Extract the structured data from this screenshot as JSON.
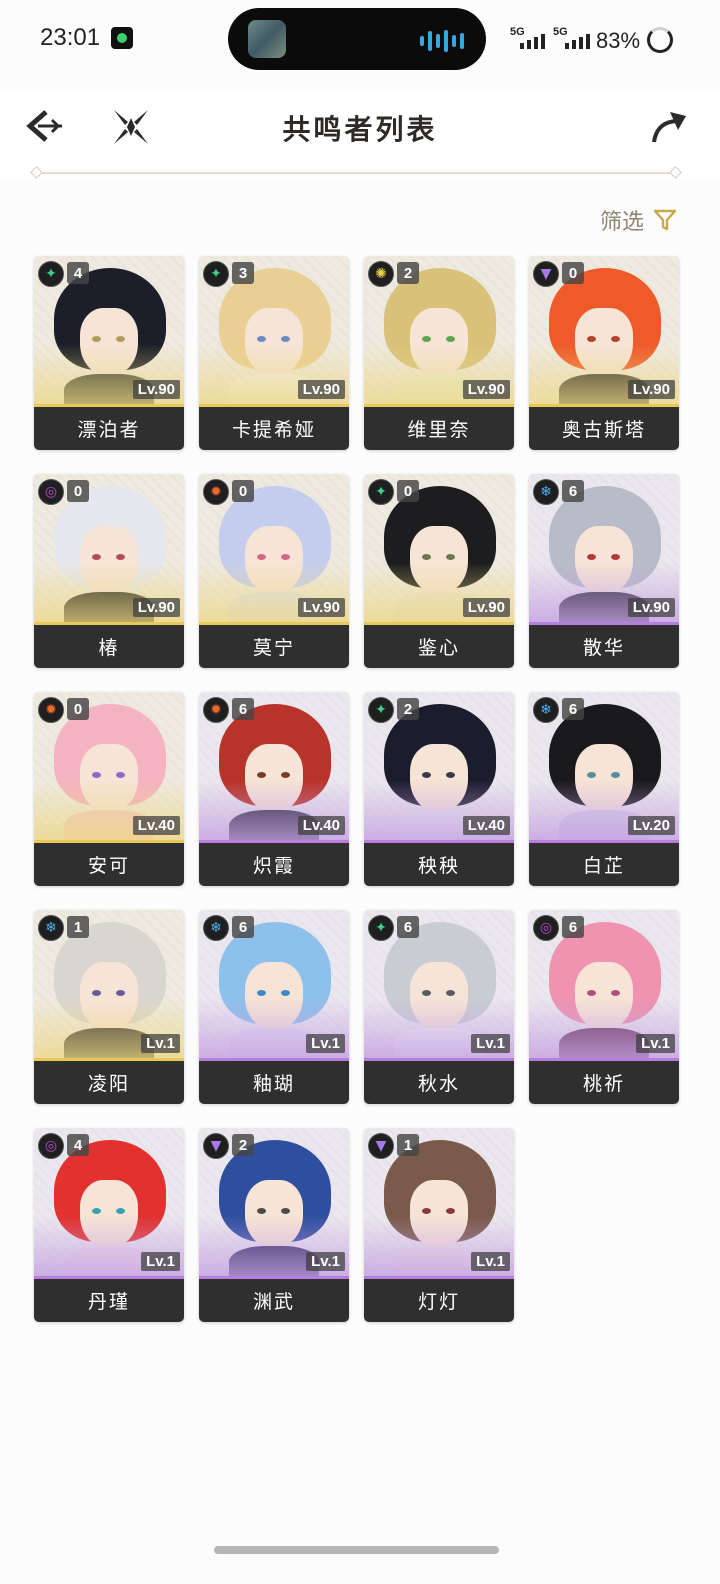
{
  "status_bar": {
    "time": "23:01",
    "network_1": "5G",
    "network_2": "5G",
    "battery": "83%"
  },
  "header": {
    "title": "共鸣者列表",
    "back_icon": "back-arrow-icon",
    "center_icon": "cross-blades-icon",
    "share_icon": "share-arrow-icon"
  },
  "filter": {
    "label": "筛选",
    "icon": "funnel-filter-icon"
  },
  "element_colors": {
    "aero": "#3ecf8e",
    "spectro": "#e8d14a",
    "havoc": "#c14bd8",
    "fusion": "#ef6a2a",
    "glacio": "#4ab0f0",
    "electro": "#a777ee"
  },
  "characters": [
    {
      "name": "漂泊者",
      "level": "Lv.90",
      "chain": "4",
      "element": "aero",
      "rarity": "gold",
      "hair": "#1c1f2a",
      "eye": "#b49a5a",
      "outfit": "#3b3f35"
    },
    {
      "name": "卡提希娅",
      "level": "Lv.90",
      "chain": "3",
      "element": "aero",
      "rarity": "gold",
      "hair": "#e9cf93",
      "eye": "#6a8ac6",
      "outfit": "#f3efe6"
    },
    {
      "name": "维里奈",
      "level": "Lv.90",
      "chain": "2",
      "element": "spectro",
      "rarity": "gold",
      "hair": "#d8c27a",
      "eye": "#5fa34f",
      "outfit": "#e8ecd3"
    },
    {
      "name": "奥古斯塔",
      "level": "Lv.90",
      "chain": "0",
      "element": "electro",
      "rarity": "gold",
      "hair": "#ef5a2a",
      "eye": "#b0442a",
      "outfit": "#343030"
    },
    {
      "name": "椿",
      "level": "Lv.90",
      "chain": "0",
      "element": "havoc",
      "rarity": "gold",
      "hair": "#e6e7ec",
      "eye": "#b34a5a",
      "outfit": "#2a2a2a"
    },
    {
      "name": "莫宁",
      "level": "Lv.90",
      "chain": "0",
      "element": "fusion",
      "rarity": "gold",
      "hair": "#c4cdee",
      "eye": "#d06a8a",
      "outfit": "#dfe1ee"
    },
    {
      "name": "鉴心",
      "level": "Lv.90",
      "chain": "0",
      "element": "aero",
      "rarity": "gold",
      "hair": "#1d1d1f",
      "eye": "#6a7a4a",
      "outfit": "#e9e4d4"
    },
    {
      "name": "散华",
      "level": "Lv.90",
      "chain": "6",
      "element": "glacio",
      "rarity": "purple",
      "hair": "#b8bcc8",
      "eye": "#b33a3a",
      "outfit": "#2f2d38"
    },
    {
      "name": "安可",
      "level": "Lv.40",
      "chain": "0",
      "element": "fusion",
      "rarity": "gold",
      "hair": "#f3b3c0",
      "eye": "#8a6ac6",
      "outfit": "#f2c9c9"
    },
    {
      "name": "炽霞",
      "level": "Lv.40",
      "chain": "6",
      "element": "fusion",
      "rarity": "purple",
      "hair": "#b8342a",
      "eye": "#7a3a2a",
      "outfit": "#2a2a36"
    },
    {
      "name": "秧秧",
      "level": "Lv.40",
      "chain": "2",
      "element": "aero",
      "rarity": "purple",
      "hair": "#1b1d2c",
      "eye": "#3a3a4a",
      "outfit": "#e9e9ef"
    },
    {
      "name": "白芷",
      "level": "Lv.20",
      "chain": "6",
      "element": "glacio",
      "rarity": "purple",
      "hair": "#1a1a1c",
      "eye": "#5a8aa0",
      "outfit": "#d7cfe6"
    },
    {
      "name": "凌阳",
      "level": "Lv.1",
      "chain": "1",
      "element": "glacio",
      "rarity": "gold",
      "hair": "#d9d6cf",
      "eye": "#6a5aa0",
      "outfit": "#3a3a3a"
    },
    {
      "name": "釉瑚",
      "level": "Lv.1",
      "chain": "6",
      "element": "glacio",
      "rarity": "purple",
      "hair": "#8ec0ec",
      "eye": "#3a8ac8",
      "outfit": "#e2dcf0"
    },
    {
      "name": "秋水",
      "level": "Lv.1",
      "chain": "6",
      "element": "aero",
      "rarity": "purple",
      "hair": "#c9ccd3",
      "eye": "#5a5a6a",
      "outfit": "#f0f0f4"
    },
    {
      "name": "桃祈",
      "level": "Lv.1",
      "chain": "6",
      "element": "havoc",
      "rarity": "purple",
      "hair": "#ef93b0",
      "eye": "#b0507a",
      "outfit": "#6a3a5a"
    },
    {
      "name": "丹瑾",
      "level": "Lv.1",
      "chain": "4",
      "element": "havoc",
      "rarity": "purple",
      "hair": "#e2312e",
      "eye": "#3aa0b8",
      "outfit": "#f0e0e8"
    },
    {
      "name": "渊武",
      "level": "Lv.1",
      "chain": "2",
      "element": "electro",
      "rarity": "purple",
      "hair": "#2f4f9e",
      "eye": "#4a4a4a",
      "outfit": "#2a2a5a"
    },
    {
      "name": "灯灯",
      "level": "Lv.1",
      "chain": "1",
      "element": "electro",
      "rarity": "purple",
      "hair": "#7a5a4a",
      "eye": "#8a3a3a",
      "outfit": "#efe6e6"
    }
  ]
}
